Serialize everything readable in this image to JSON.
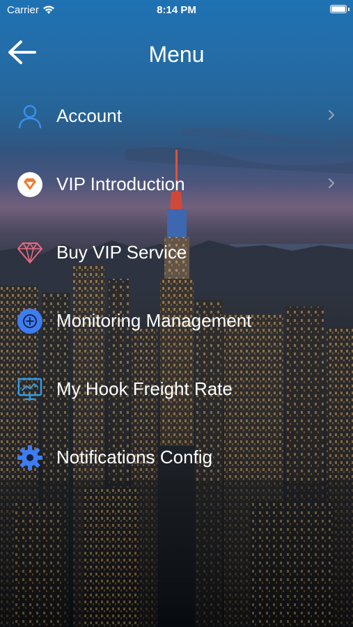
{
  "status_bar": {
    "carrier": "Carrier",
    "time": "8:14 PM",
    "wifi_icon": "wifi-icon",
    "battery_icon": "battery-icon"
  },
  "header": {
    "title": "Menu",
    "back_icon": "arrow-left-icon"
  },
  "menu": {
    "items": [
      {
        "label": "Account",
        "icon": "user-icon",
        "icon_color": "#3a8fe8",
        "has_chevron": true
      },
      {
        "label": "VIP Introduction",
        "icon": "vip-diamond-badge-icon",
        "icon_color": "#f07b2b",
        "has_chevron": true
      },
      {
        "label": "Buy VIP Service",
        "icon": "gem-icon",
        "icon_color": "#e86a7e",
        "has_chevron": false
      },
      {
        "label": "Monitoring Management",
        "icon": "plus-circle-icon",
        "icon_color": "#3f7cf0",
        "has_chevron": false
      },
      {
        "label": "My Hook Freight Rate",
        "icon": "monitor-chart-icon",
        "icon_color": "#2f9ee8",
        "has_chevron": false
      },
      {
        "label": "Notifications Config",
        "icon": "gear-icon",
        "icon_color": "#3f7cf0",
        "has_chevron": false
      }
    ]
  },
  "colors": {
    "text": "#ffffff",
    "sky_top": "#1f72b3",
    "sky_horizon": "#6a5675",
    "city_dark": "#0b0f16"
  }
}
